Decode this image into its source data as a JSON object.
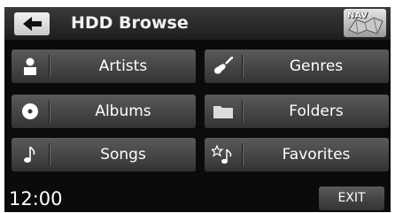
{
  "header": {
    "title": "HDD Browse",
    "back_icon": "left-arrow-icon",
    "nav_label": "NAV",
    "nav_icon": "map-icon"
  },
  "menu": {
    "items": [
      {
        "label": "Artists",
        "icon": "person-icon"
      },
      {
        "label": "Genres",
        "icon": "guitar-icon"
      },
      {
        "label": "Albums",
        "icon": "disc-icon"
      },
      {
        "label": "Folders",
        "icon": "folder-icon"
      },
      {
        "label": "Songs",
        "icon": "music-note-icon"
      },
      {
        "label": "Favorites",
        "icon": "star-note-icon"
      }
    ]
  },
  "footer": {
    "clock": "12:00",
    "exit_label": "EXIT"
  }
}
